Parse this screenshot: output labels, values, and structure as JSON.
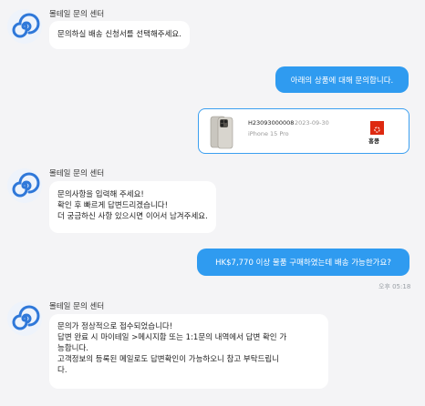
{
  "center_name": "몰테일 문의 센터",
  "messages": {
    "m1": {
      "lines": [
        "문의하실 배송 신청서를 선택해주세요."
      ]
    },
    "m2": {
      "text": "아래의 상품에 대해 문의합니다."
    },
    "product": {
      "id": "H23093000008",
      "date": "2023-09-30",
      "name": "iPhone 15 Pro",
      "region": "홍콩"
    },
    "m3": {
      "lines": [
        "문의사항을 입력해 주세요!",
        "확인 후 빠르게 답변드리겠습니다!",
        "더 궁금하신 사항 있으시면 이어서 남겨주세요."
      ]
    },
    "m4": {
      "text": "HK$7,770 이상 물품 구매하였는데 배송 가능한가요?",
      "time": "오후 05:18"
    },
    "m5": {
      "lines": [
        "문의가 정상적으로 접수되었습니다!",
        "답변 완료 시 마이테일 >메시지함 또는 1:1문의 내역에서 답변 확인 가",
        "능합니다.",
        "고객정보의 등록된 메일로도 답변확인이 가능하오니 참고 부탁드립니",
        "다."
      ]
    }
  },
  "colors": {
    "outgoing": "#2f9bf0",
    "avatar_blue": "#2f78d9",
    "border": "#3b9ff0"
  },
  "icons": {
    "avatar": "swirl-logo-icon",
    "product": "phone-thumbnail",
    "flag": "hong-kong-flag-icon"
  }
}
